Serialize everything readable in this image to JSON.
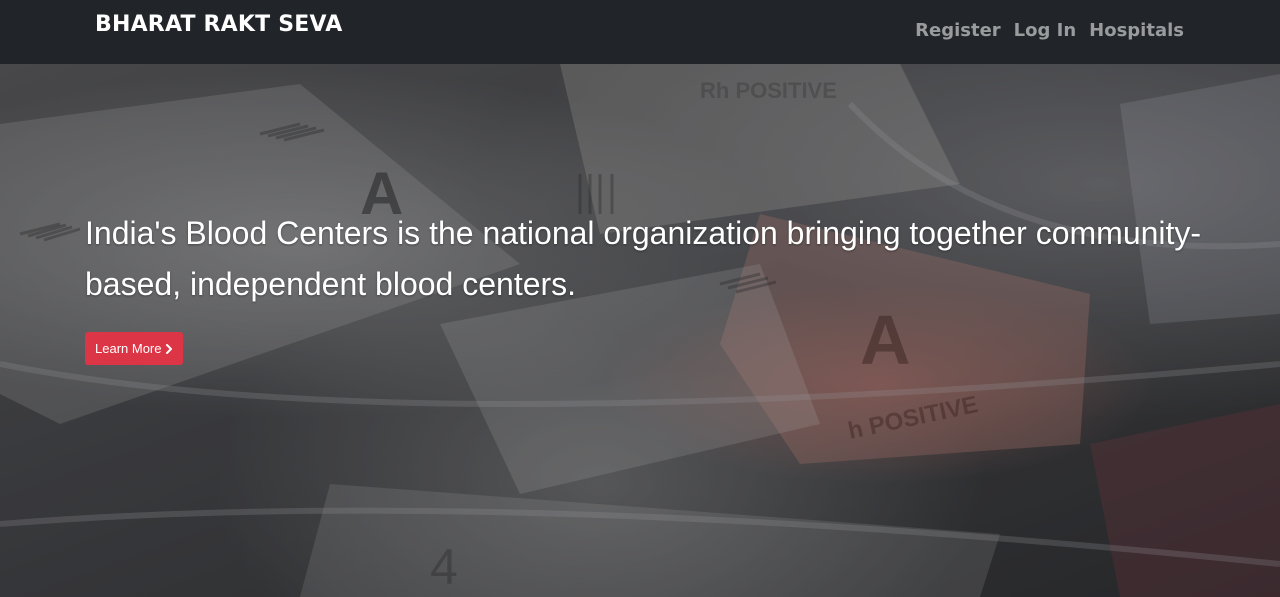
{
  "nav": {
    "brand": "BHARAT RAKT SEVA",
    "links": [
      {
        "label": "Register"
      },
      {
        "label": "Log In"
      },
      {
        "label": "Hospitals"
      }
    ]
  },
  "hero": {
    "headline": "India's Blood Centers is the national organization bringing together community-based, independent blood centers.",
    "button_label": "Learn More",
    "button_icon": "chevron-right-icon"
  },
  "colors": {
    "navbar_bg": "#212529",
    "nav_link": "#9a9b9d",
    "button_bg": "#dc3545"
  }
}
